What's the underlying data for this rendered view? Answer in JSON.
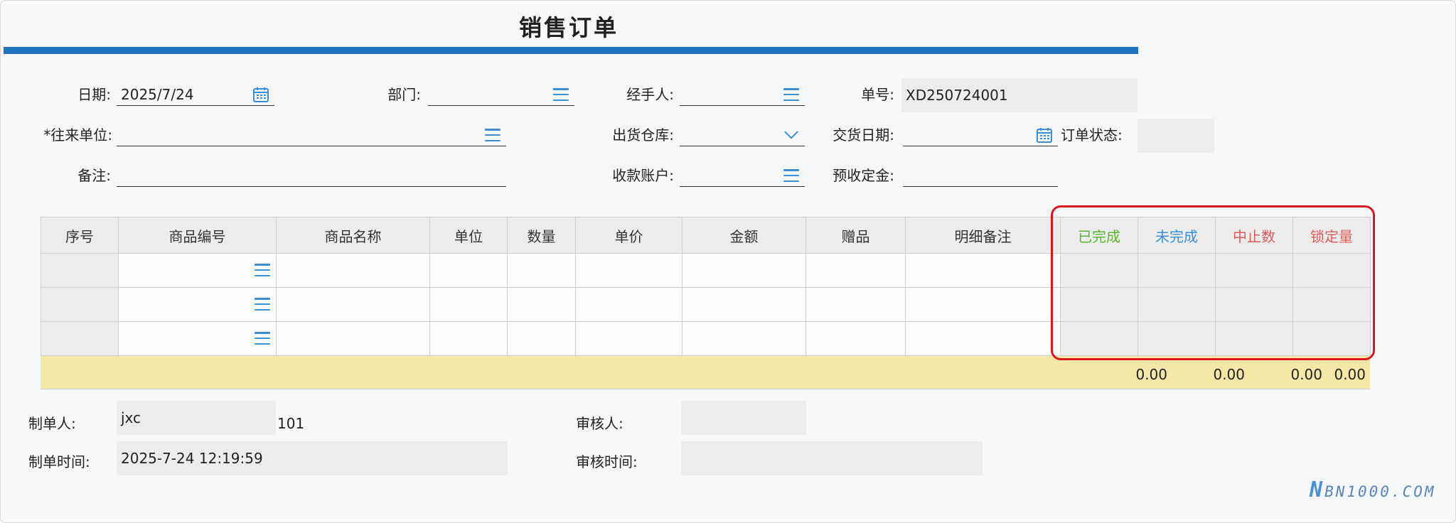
{
  "title": "销售订单",
  "header": {
    "date_label": "日期:",
    "date_value": "2025/7/24",
    "dept_label": "部门:",
    "handler_label": "经手人:",
    "order_no_label": "单号:",
    "order_no_value": "XD250724001",
    "partner_label": "*往来单位:",
    "warehouse_label": "出货仓库:",
    "delivery_date_label": "交货日期:",
    "order_status_label": "订单状态:",
    "remark_label": "备注:",
    "account_label": "收款账户:",
    "deposit_label": "预收定金:"
  },
  "table": {
    "columns": [
      "序号",
      "商品编号",
      "商品名称",
      "单位",
      "数量",
      "单价",
      "金额",
      "赠品",
      "明细备注",
      "已完成",
      "未完成",
      "中止数",
      "锁定量"
    ],
    "column_colors": {
      "已完成": "#5cb531",
      "未完成": "#3a8fd6",
      "中止数": "#e05a5a",
      "锁定量": "#e05a5a"
    },
    "row_count": 3,
    "totals": [
      "0.00",
      "0.00",
      "0.00",
      "0.00"
    ]
  },
  "footer": {
    "creator_label": "制单人:",
    "creator_value": "jxc",
    "creator_code": "101",
    "reviewer_label": "审核人:",
    "create_time_label": "制单时间:",
    "create_time_value": "2025-7-24 12:19:59",
    "review_time_label": "审核时间:"
  },
  "watermark": {
    "letter": "N",
    "text": "BN1000.COM"
  },
  "icons": {
    "list": "list-icon",
    "calendar": "calendar-icon",
    "dropdown": "chevron-down-icon"
  },
  "colors": {
    "accent": "#1e73be",
    "icon": "#3a8fd6",
    "highlight": "#d8171e",
    "summary": "#f4e8a6"
  }
}
